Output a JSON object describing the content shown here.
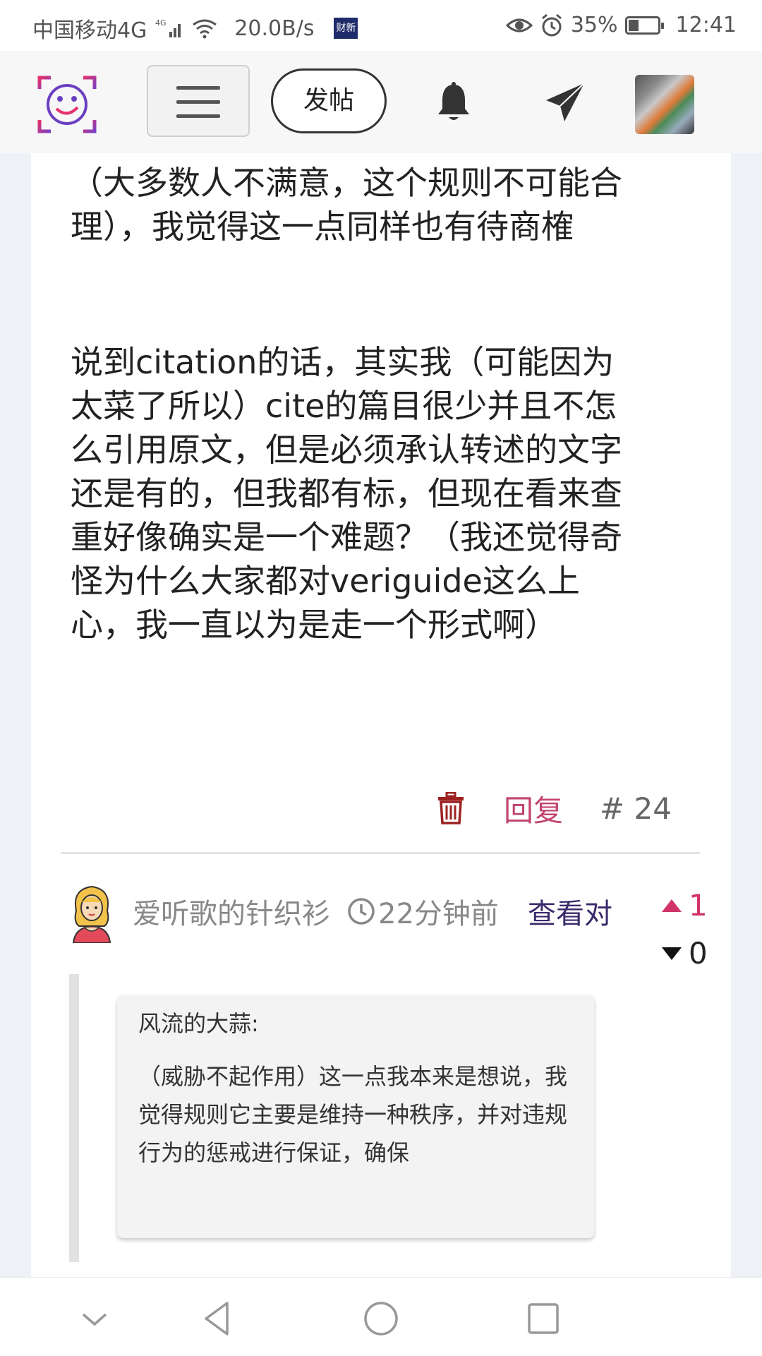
{
  "status_bar": {
    "carrier": "中国移动4G",
    "network_badge": "4G",
    "speed": "20.0B/s",
    "news_app_badge": "财新",
    "battery_percent": "35%",
    "battery_level": 0.35,
    "time": "12:41"
  },
  "top_bar": {
    "logo_icon": "smiley-logo-icon",
    "menu_icon": "hamburger-menu-icon",
    "post_button_label": "发帖",
    "notification_icon": "bell-icon",
    "message_icon": "paper-plane-icon"
  },
  "post": {
    "paragraph_1": "（大多数人不满意，这个规则不可能合理），我觉得这一点同样也有待商榷",
    "paragraph_2": "说到citation的话，其实我（可能因为太菜了所以）cite的篇目很少并且不怎么引用原文，但是必须承认转述的文字还是有的，但我都有标，但现在看来查重好像确实是一个难题？（我还觉得奇怪为什么大家都对veriguide这么上心，我一直以为是走一个形式啊）",
    "reply_label": "回复",
    "floor_label": "# 24"
  },
  "comment": {
    "author": "爱听歌的针织衫",
    "time_ago": "22分钟前",
    "view_pair_label": "查看对",
    "upvotes": "1",
    "downvotes": "0",
    "quote": {
      "author": "风流的大蒜:",
      "text": "（威胁不起作用）这一点我本来是想说，我觉得规则它主要是维持一种秩序，并对违规行为的惩戒进行保证，确保"
    }
  },
  "colors": {
    "accent_pink": "#c2456e",
    "upvote_pink": "#d0346a",
    "link_purple": "#3a2a6a",
    "trash_red": "#9c2222"
  }
}
